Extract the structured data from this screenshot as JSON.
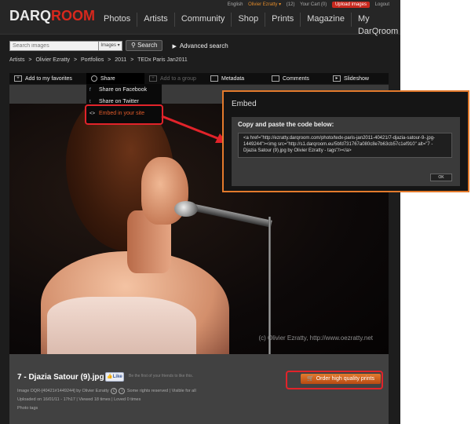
{
  "header": {
    "logo_dark": "DARQ",
    "logo_room": "ROOM",
    "utilities": {
      "english": "English",
      "user": "Olivier Ezratty ▾",
      "messages": "(12)",
      "cart": "Your Cart (0)",
      "upload": "Upload images",
      "logout": "Logout"
    },
    "nav": [
      "Photos",
      "Artists",
      "Community",
      "Shop",
      "Prints",
      "Magazine",
      "My DarQroom"
    ]
  },
  "search": {
    "placeholder": "Search images",
    "scope": "Images ▾",
    "button": "Search",
    "advanced": "Advanced search"
  },
  "breadcrumb": [
    "Artists",
    ">",
    "Olivier Ezratty",
    ">",
    "Portfolios",
    ">",
    "2011",
    ">",
    "TEDx Paris Jan2011"
  ],
  "toolbar": {
    "favorites": "Add to my favorites",
    "share": "Share",
    "add_group": "Add to a group",
    "metadata": "Metadata",
    "comments": "Comments",
    "slideshow": "Slideshow"
  },
  "share_menu": {
    "facebook": "Share on Facebook",
    "twitter": "Share on Twitter",
    "embed": "Embed in your site"
  },
  "photo": {
    "copyright": "(c) Olivier Ezratty, http://www.oezratty.net",
    "title": "7 - Djazia Satour (9).jpg",
    "like_label": "Like",
    "like_text": "Be the first of your friends to like this.",
    "meta_line1_prefix": "Image DQR-[40421#1449244] by Olivier Ezratty",
    "meta_line1_suffix": "Some rights reserved | Visible for all",
    "meta_line2": "Uploaded on 16/01/11 - 17h17 | Viewed 18 times | Loved 0 times",
    "meta_line3": "Photo tags",
    "order_button": "Order high quality prints"
  },
  "embed_dialog": {
    "title": "Embed",
    "label": "Copy and paste the code below:",
    "code": "<a href=\"http://ezratty.darqroom.com/photo/tedx-paris-jan2011-40421/7-djazia-satour-9-.jpg-1449244\"><img src=\"http://s1.darqroom.eu/5bfd731767a080c8e7b63cb57c1ef910\" alt=\"7 - Djazia Satour (9).jpg by Olivier Ezratty - tags\"/></a>",
    "ok": "OK"
  },
  "colors": {
    "accent_red": "#e2232a",
    "dialog_border": "#e37a2c",
    "order_button": "#d0621f",
    "embed_link": "#e05a2a"
  }
}
